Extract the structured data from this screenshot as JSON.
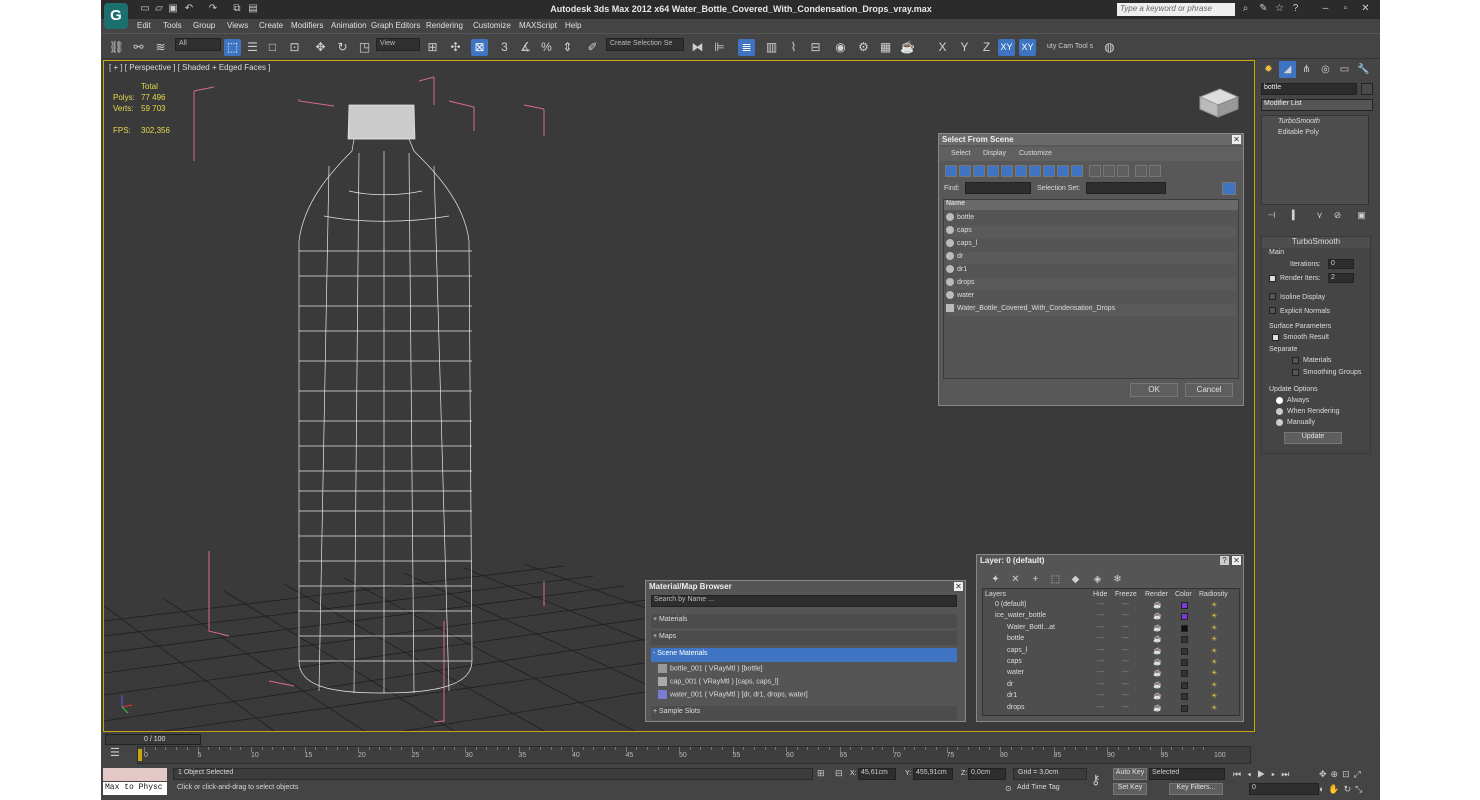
{
  "app": {
    "title": "Autodesk 3ds Max  2012 x64     Water_Bottle_Covered_With_Condensation_Drops_vray.max",
    "search_placeholder": "Type a keyword or phrase",
    "logo": "G"
  },
  "menu": [
    "Edit",
    "Tools",
    "Group",
    "Views",
    "Create",
    "Modifiers",
    "Animation",
    "Graph Editors",
    "Rendering",
    "Customize",
    "MAXScript",
    "Help"
  ],
  "toolbar": {
    "filter_value": "All",
    "ref_coord_value": "View",
    "selection_set_placeholder": "Create Selection Se",
    "axis_x": "X",
    "axis_y": "Y",
    "axis_z": "Z",
    "axis_xy": "XY",
    "axis_xy2": "XY",
    "extra_label": "uty Cam Tool s",
    "snap_3": "3",
    "snap_2_5": "2.5"
  },
  "viewport": {
    "label": "[ + ] [ Perspective ] [ Shaded + Edged Faces ]",
    "stats": {
      "total_label": "Total",
      "polys_label": "Polys:",
      "polys_value": "77 496",
      "verts_label": "Verts:",
      "verts_value": "59 703",
      "fps_label": "FPS:",
      "fps_value": "302,356"
    }
  },
  "select_dialog": {
    "title": "Select From Scene",
    "menus": [
      "Select",
      "Display",
      "Customize"
    ],
    "find_label": "Find:",
    "selection_set_label": "Selection Set:",
    "column_name": "Name",
    "items": [
      "bottle",
      "caps",
      "caps_l",
      "dr",
      "dr1",
      "drops",
      "water",
      "Water_Bottle_Covered_With_Condensation_Drops"
    ],
    "ok": "OK",
    "cancel": "Cancel"
  },
  "material_browser": {
    "title": "Material/Map Browser",
    "search_placeholder": "Search by Name ...",
    "sections": {
      "materials": "+ Materials",
      "maps": "+ Maps",
      "scene": "- Scene Materials",
      "sample": "+ Sample Slots"
    },
    "scene_items": [
      "bottle_001  ( VRayMtl )  [bottle]",
      "cap_001  ( VRayMtl )  [caps, caps_l]",
      "water_001  ( VRayMtl )  [dr, dr1, drops, water]"
    ]
  },
  "layers_panel": {
    "title": "Layer: 0 (default)",
    "help": "?",
    "columns": [
      "Layers",
      "Hide",
      "Freeze",
      "Render",
      "Color",
      "Radiosity"
    ],
    "rows": [
      {
        "name": "0 (default)",
        "color": "#7a3ad6"
      },
      {
        "name": "ice_water_bottle",
        "color": "#7a3ad6"
      },
      {
        "name": "Water_Bottl...at",
        "color": "#111111"
      },
      {
        "name": "bottle",
        "color": "#333333"
      },
      {
        "name": "caps_l",
        "color": "#333333"
      },
      {
        "name": "caps",
        "color": "#333333"
      },
      {
        "name": "water",
        "color": "#333333"
      },
      {
        "name": "dr",
        "color": "#333333"
      },
      {
        "name": "dr1",
        "color": "#333333"
      },
      {
        "name": "drops",
        "color": "#333333"
      }
    ]
  },
  "command_panel": {
    "object_name": "bottle",
    "modifier_list": "Modifier List",
    "stack": [
      "TurboSmooth",
      "Editable Poly"
    ],
    "rollout_title": "TurboSmooth",
    "main_label": "Main",
    "iterations_label": "Iterations:",
    "iterations_value": "0",
    "render_iters_label": "Render Iters:",
    "render_iters_value": "2",
    "isoline_label": "Isoline Display",
    "explicit_label": "Explicit Normals",
    "surface_label": "Surface Parameters",
    "smooth_result_label": "Smooth Result",
    "separate_label": "Separate",
    "materials_label": "Materials",
    "smoothing_groups_label": "Smoothing Groups",
    "update_options_label": "Update Options",
    "always_label": "Always",
    "when_rendering_label": "When Rendering",
    "manually_label": "Manually",
    "update_button": "Update"
  },
  "timeline": {
    "frame_label": "0 / 100",
    "ticks": [
      "0",
      "5",
      "10",
      "15",
      "20",
      "25",
      "30",
      "35",
      "40",
      "45",
      "50",
      "55",
      "60",
      "65",
      "70",
      "75",
      "80",
      "85",
      "90",
      "95",
      "100"
    ]
  },
  "status": {
    "maxscript_label": "Max to Physc",
    "selected_text": "1 Object Selected",
    "prompt_text": "Click or click-and-drag to select objects",
    "x_label": "X:",
    "x_value": "45,61cm",
    "y_label": "Y:",
    "y_value": "455,91cm",
    "z_label": "Z:",
    "z_value": "0,0cm",
    "grid_text": "Grid = 3,0cm",
    "add_time_tag": "Add Time Tag",
    "auto_key": "Auto Key",
    "set_key": "Set Key",
    "selected_dropdown": "Selected",
    "key_filters": "Key Filters...",
    "frame_value": "0"
  },
  "colors": {
    "accent": "#3e74c2",
    "viewport_border": "#c9a80f",
    "stats_yellow": "#e3d94a",
    "box_pink": "#d86a96"
  }
}
